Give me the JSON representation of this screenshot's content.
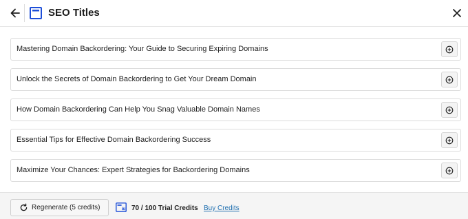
{
  "header": {
    "title": "SEO Titles",
    "back_icon": "arrow-left-icon",
    "title_icon": "window-icon",
    "close_icon": "close-icon"
  },
  "titles": [
    "Mastering Domain Backordering: Your Guide to Securing Expiring Domains",
    "Unlock the Secrets of Domain Backordering to Get Your Dream Domain",
    "How Domain Backordering Can Help You Snag Valuable Domain Names",
    "Essential Tips for Effective Domain Backordering Success",
    "Maximize Your Chances: Expert Strategies for Backordering Domains"
  ],
  "row_action_icon": "plus-circle-icon",
  "footer": {
    "regenerate_label": "Regenerate (5 credits)",
    "regenerate_icon": "refresh-icon",
    "credits_icon": "ai-credits-icon",
    "credits_text": "70 / 100 Trial Credits",
    "buy_credits_label": "Buy Credits"
  },
  "colors": {
    "accent": "#1d4ed8",
    "link": "#2271b1",
    "text": "#1e1e1e"
  }
}
